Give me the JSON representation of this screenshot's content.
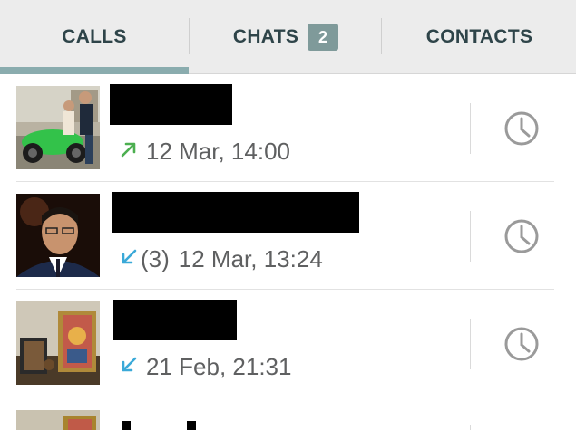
{
  "tabs": {
    "calls": "CALLS",
    "chats": "CHATS",
    "chats_badge": "2",
    "contacts": "CONTACTS",
    "active": "calls"
  },
  "calls": [
    {
      "direction": "outgoing",
      "direction_color": "#4caf50",
      "count": "",
      "time": "12 Mar, 14:00"
    },
    {
      "direction": "incoming",
      "direction_color": "#3aa9d8",
      "count": "(3)",
      "time": "12 Mar, 13:24"
    },
    {
      "direction": "incoming",
      "direction_color": "#3aa9d8",
      "count": "",
      "time": "21 Feb, 21:31"
    }
  ],
  "icons": {
    "outgoing": "arrow-up-right-icon",
    "incoming": "arrow-down-left-icon",
    "action": "clock-icon"
  },
  "colors": {
    "tab_bar": "#ececec",
    "tab_text": "#2e4449",
    "badge": "#7f9a9a",
    "active_indicator": "#8aacae",
    "meta_text": "#5f6061",
    "clock": "#9a9a9a"
  }
}
